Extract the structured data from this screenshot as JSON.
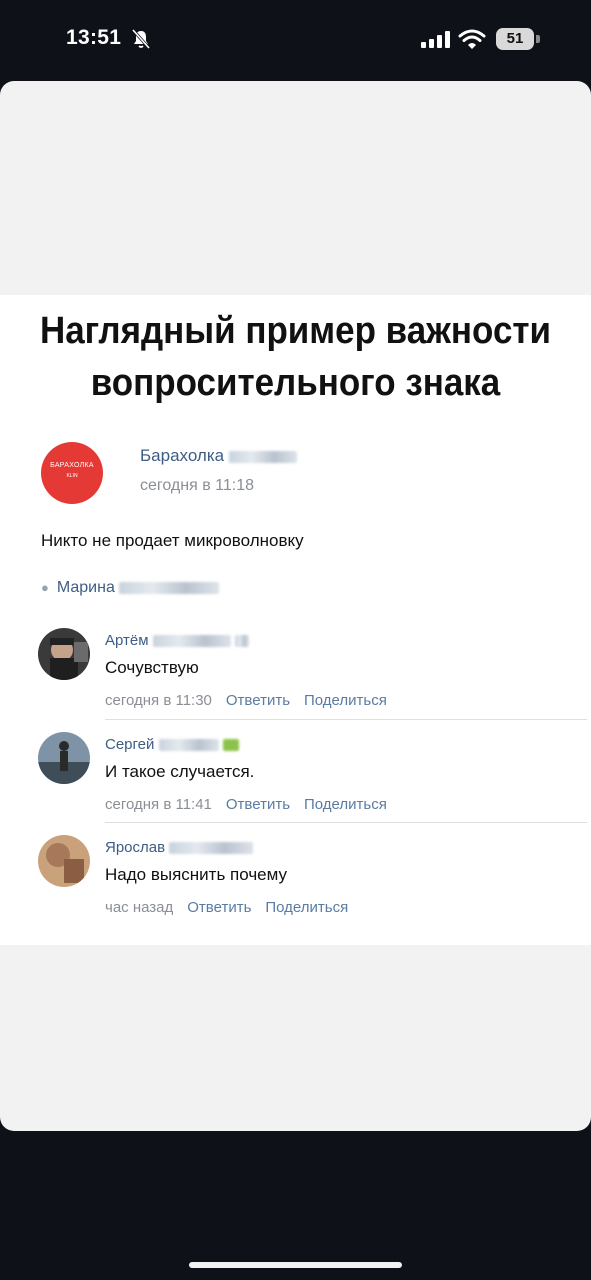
{
  "status_bar": {
    "time": "13:51",
    "battery": "51"
  },
  "meme": {
    "headline_line1": "Наглядный пример важности",
    "headline_line2": "вопросительного знака"
  },
  "post": {
    "group_logo_text": "БАРАХОЛКА",
    "group_logo_sub": "KLIN",
    "group_name": "Барахолка",
    "time": "сегодня в 11:18",
    "text": "Никто не продает микроволновку",
    "author": "Марина"
  },
  "comments": [
    {
      "name": "Артём",
      "text": "Сочувствую",
      "time": "сегодня в 11:30",
      "reply": "Ответить",
      "share": "Поделиться"
    },
    {
      "name": "Сергей",
      "text": "И такое случается.",
      "time": "сегодня в 11:41",
      "reply": "Ответить",
      "share": "Поделиться"
    },
    {
      "name": "Ярослав",
      "text": "Надо выяснить почему",
      "time": "час назад",
      "reply": "Ответить",
      "share": "Поделиться"
    }
  ]
}
